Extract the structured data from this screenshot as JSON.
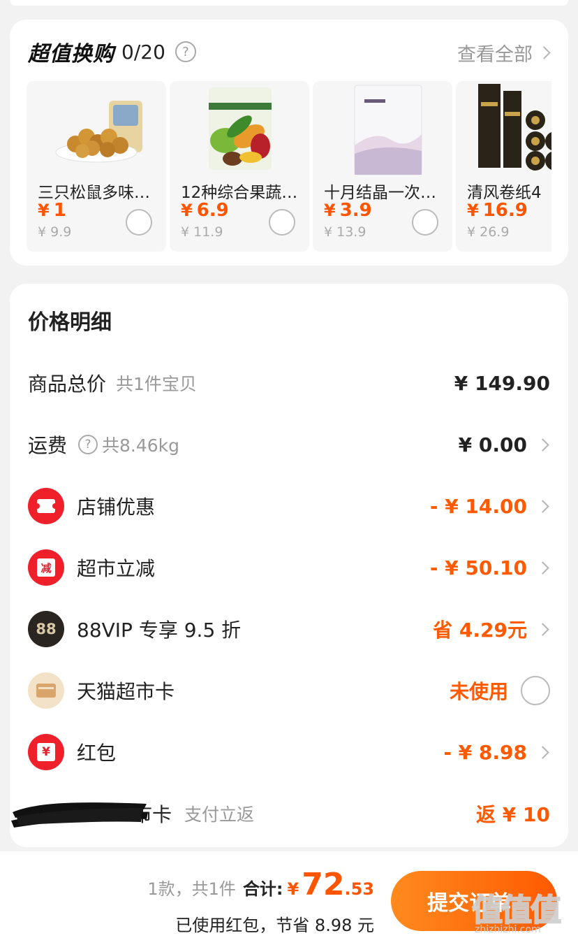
{
  "exchange": {
    "title": "超值换购",
    "count": "0/20",
    "help_glyph": "?",
    "view_all": "查看全部",
    "items": [
      {
        "name": "三只松鼠多味…",
        "price": "1",
        "original": "¥ 9.9"
      },
      {
        "name": "12种综合果蔬…",
        "price": "6.9",
        "original": "¥ 11.9"
      },
      {
        "name": "十月结晶一次…",
        "price": "3.9",
        "original": "¥ 13.9"
      },
      {
        "name": "清风卷纸4",
        "price": "16.9",
        "original": "¥ 26.9"
      }
    ],
    "currency": "¥"
  },
  "detail": {
    "title": "价格明细",
    "goods": {
      "label": "商品总价",
      "sub": "共1件宝贝",
      "amount": "¥ 149.90"
    },
    "shipping": {
      "label": "运费",
      "sub": "共8.46kg",
      "amount": "¥ 0.00"
    },
    "store_discount": {
      "label": "店铺优惠",
      "amount": "- ¥ 14.00"
    },
    "market_cut": {
      "label": "超市立减",
      "icon_char": "减",
      "amount": "- ¥ 50.10"
    },
    "vip": {
      "label": "88VIP 专享 9.5 折",
      "icon_text": "88",
      "amount": "省 4.29元"
    },
    "tmall_card": {
      "label": "天猫超市卡",
      "status": "未使用"
    },
    "red_packet": {
      "label": "红包",
      "icon_char": "¥",
      "amount": "- ¥ 8.98"
    },
    "cashback": {
      "label_tail": "市卡",
      "sub": "支付立返",
      "amount": "返 ¥ 10"
    }
  },
  "footer": {
    "count_text": "1款，共1件",
    "total_label": "合计:",
    "total_yen": "¥",
    "total_int": "72",
    "total_dec": ".53",
    "savings": "已使用红包，节省 8.98 元",
    "submit": "提交订单"
  },
  "watermark": {
    "text": "值值值",
    "url": "zhizhizhi.com"
  },
  "colors": {
    "accent": "#ff5500",
    "red_icon": "#f0202a",
    "background": "#f2f2f2"
  }
}
